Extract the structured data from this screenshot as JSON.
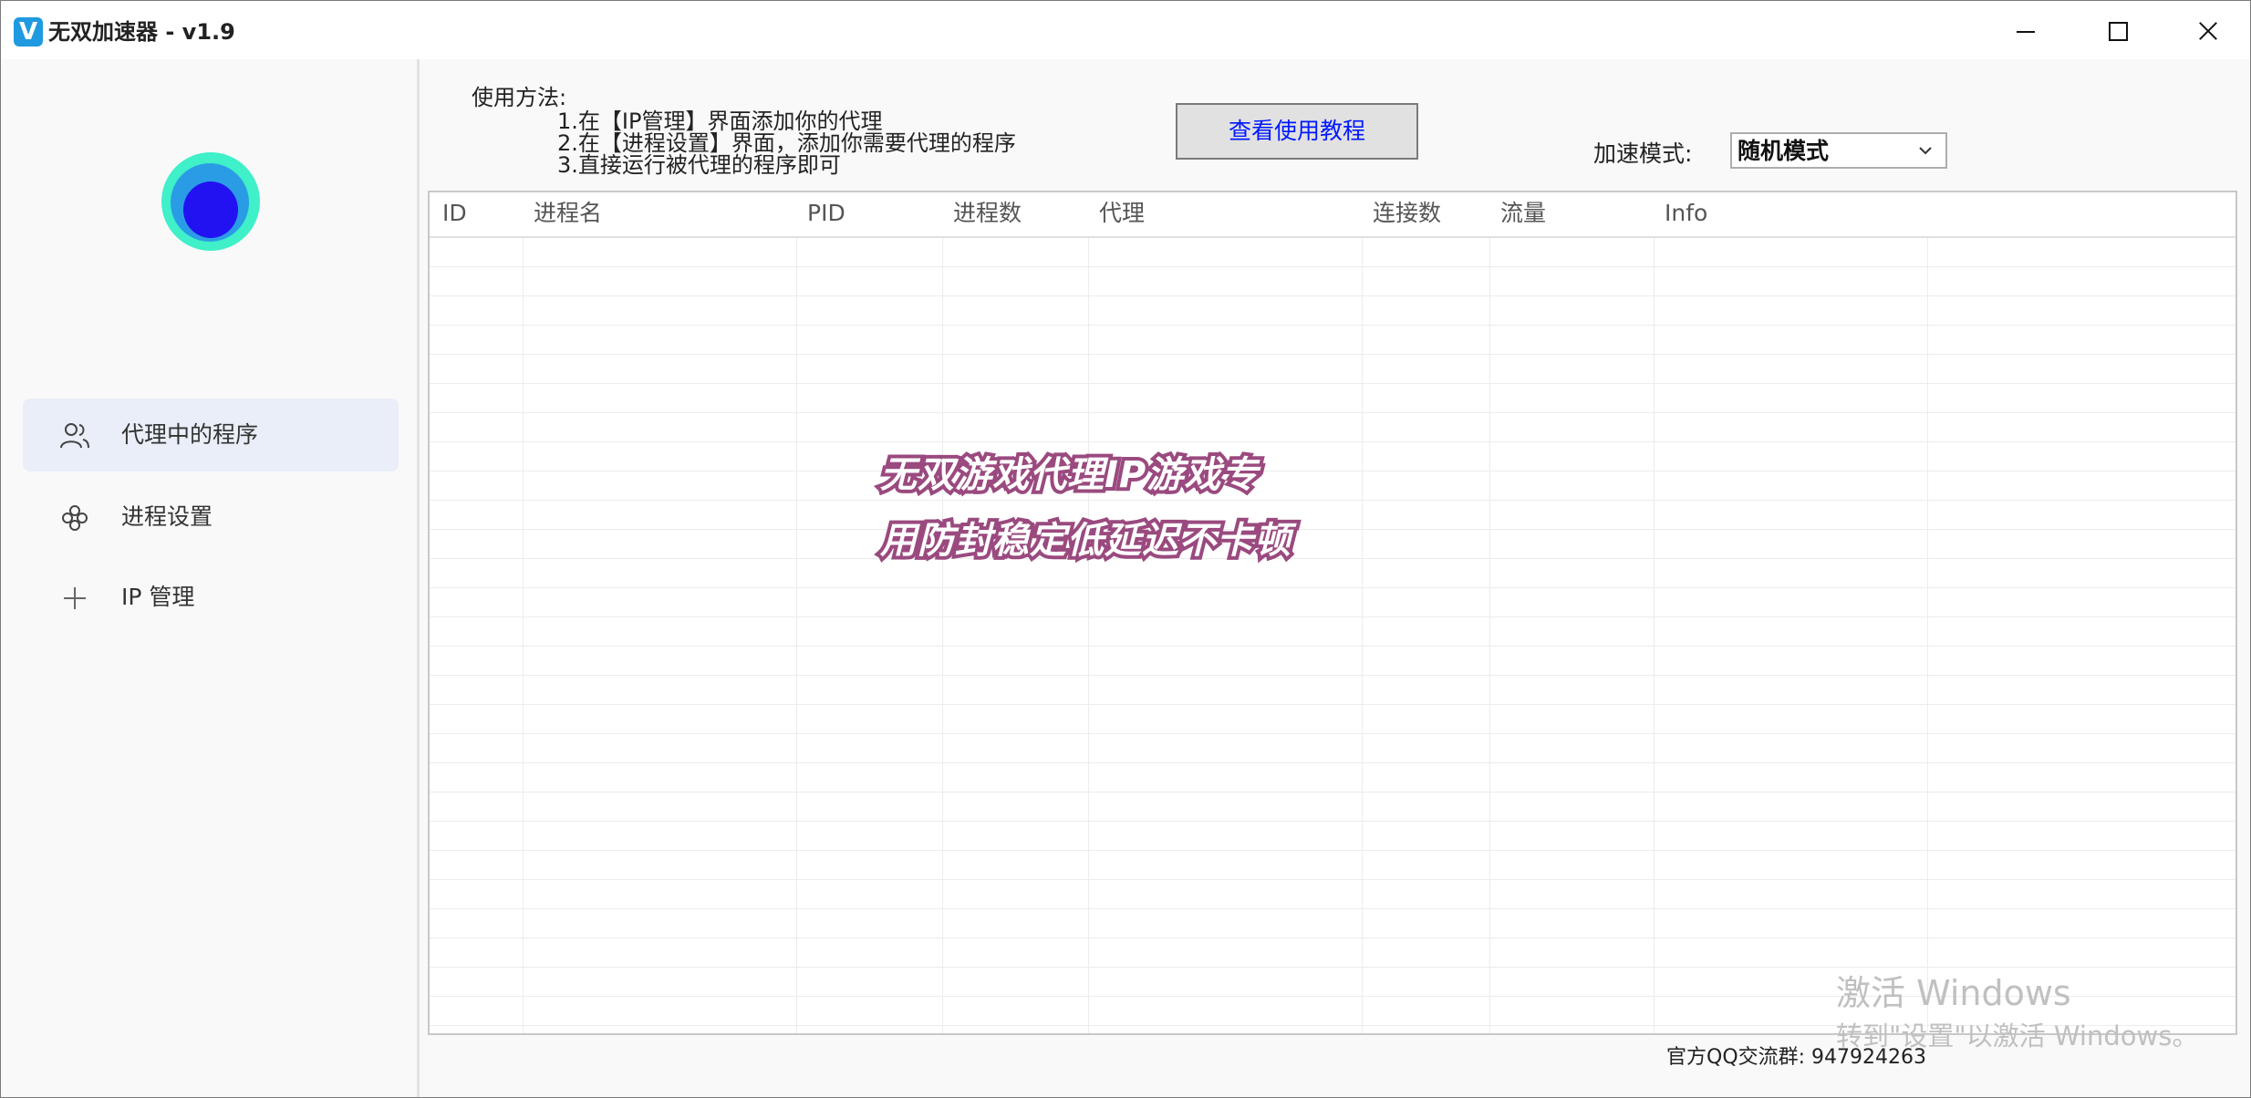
{
  "window": {
    "title": "无双加速器 - v1.9",
    "app_icon": "V"
  },
  "sidebar": {
    "items": [
      {
        "label": "代理中的程序",
        "icon": "user-icon",
        "active": true
      },
      {
        "label": "进程设置",
        "icon": "process-settings-icon",
        "active": false
      },
      {
        "label": "IP 管理",
        "icon": "plus-icon",
        "active": false
      }
    ]
  },
  "usage": {
    "title": "使用方法:",
    "steps": [
      "1.在【IP管理】界面添加你的代理",
      "2.在【进程设置】界面，添加你需要代理的程序",
      "3.直接运行被代理的程序即可"
    ]
  },
  "tutorial_button": "查看使用教程",
  "mode": {
    "label": "加速模式:",
    "selected": "随机模式"
  },
  "table": {
    "columns": [
      "ID",
      "进程名",
      "PID",
      "进程数",
      "代理",
      "连接数",
      "流量",
      "Info"
    ],
    "rows": []
  },
  "promo": {
    "line1": "无双游戏代理IP游戏专",
    "line2": "用防封稳定低延迟不卡顿"
  },
  "footer": {
    "qq_group": "官方QQ交流群: 947924263"
  },
  "watermark": {
    "title": "激活 Windows",
    "subtitle": "转到\"设置\"以激活 Windows。"
  },
  "colors": {
    "accent_link": "#0018ff",
    "promo_outline": "#9a4a7f",
    "active_nav_bg": "#e9eef8"
  }
}
